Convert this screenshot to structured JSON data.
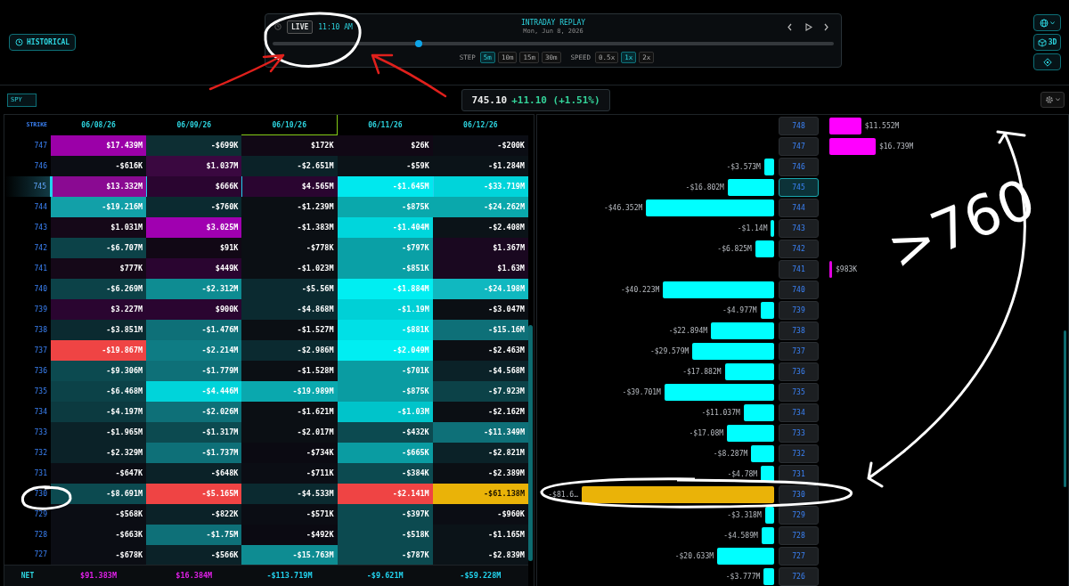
{
  "historical": {
    "label": "HISTORICAL"
  },
  "replay": {
    "live_label": "LIVE",
    "time": "11:10 AM",
    "title": "INTRADAY REPLAY",
    "date": "Mon, Jun 8, 2026",
    "level": 0.26,
    "step_label": "STEP",
    "steps": [
      {
        "label": "5m",
        "selected": true
      },
      {
        "label": "10m",
        "selected": false
      },
      {
        "label": "15m",
        "selected": false
      },
      {
        "label": "30m",
        "selected": false
      }
    ],
    "speed_label": "SPEED",
    "speeds": [
      {
        "label": "0.5x",
        "selected": false
      },
      {
        "label": "1x",
        "selected": true
      },
      {
        "label": "2x",
        "selected": false
      }
    ]
  },
  "side_buttons": [
    {
      "kind": "globe"
    },
    {
      "kind": "cube",
      "label": "3D"
    },
    {
      "kind": "diamond"
    }
  ],
  "symbol_field": {
    "value": "SPY"
  },
  "quote": {
    "price": "745.10",
    "change": "+11.10 (+1.51%)"
  },
  "table": {
    "strike_header": "STRIKE",
    "columns": [
      {
        "label": "06/08/26",
        "selected": false
      },
      {
        "label": "06/09/26",
        "selected": false
      },
      {
        "label": "06/10/26",
        "selected": true
      },
      {
        "label": "06/11/26",
        "selected": false
      },
      {
        "label": "06/12/26",
        "selected": false
      }
    ],
    "rows": [
      {
        "strike": "747",
        "current": false,
        "cells": [
          {
            "value": "$17.439M",
            "color": "#9b00a8"
          },
          {
            "value": "-$699K",
            "color": "#0d2e33"
          },
          {
            "value": "$172K",
            "color": "#110815"
          },
          {
            "value": "$26K",
            "color": "#110815"
          },
          {
            "value": "-$200K",
            "color": "#0b0d14"
          }
        ]
      },
      {
        "strike": "746",
        "current": false,
        "cells": [
          {
            "value": "-$616K",
            "color": "#0b0d14"
          },
          {
            "value": "$1.037M",
            "color": "#3a0840"
          },
          {
            "value": "-$2.651M",
            "color": "#0b2228"
          },
          {
            "value": "-$59K",
            "color": "#0b1318"
          },
          {
            "value": "-$1.284M",
            "color": "#0b1318"
          }
        ]
      },
      {
        "strike": "745",
        "current": true,
        "cells": [
          {
            "value": "$13.332M",
            "color": "#8a0a92"
          },
          {
            "value": "$666K",
            "color": "#2a0530"
          },
          {
            "value": "$4.565M",
            "color": "#2a0530"
          },
          {
            "value": "-$1.645M",
            "color": "#00e8ee"
          },
          {
            "value": "-$33.719M",
            "color": "#00d4da"
          }
        ]
      },
      {
        "strike": "744",
        "current": false,
        "cells": [
          {
            "value": "-$19.216M",
            "color": "#12a0a8"
          },
          {
            "value": "-$760K",
            "color": "#0b2a30"
          },
          {
            "value": "-$1.239M",
            "color": "#0b0f14"
          },
          {
            "value": "-$875K",
            "color": "#0aa8ac"
          },
          {
            "value": "-$24.262M",
            "color": "#0aa8ac"
          }
        ]
      },
      {
        "strike": "743",
        "current": false,
        "cells": [
          {
            "value": "$1.031M",
            "color": "#150818"
          },
          {
            "value": "$3.025M",
            "color": "#a000b0"
          },
          {
            "value": "-$1.383M",
            "color": "#0b0f14"
          },
          {
            "value": "-$1.404M",
            "color": "#00d6dc"
          },
          {
            "value": "-$2.408M",
            "color": "#0b1318"
          }
        ]
      },
      {
        "strike": "742",
        "current": false,
        "cells": [
          {
            "value": "-$6.707M",
            "color": "#0c4248"
          },
          {
            "value": "$91K",
            "color": "#110815"
          },
          {
            "value": "-$778K",
            "color": "#0b0f14"
          },
          {
            "value": "-$797K",
            "color": "#0aa0a6"
          },
          {
            "value": "$1.367M",
            "color": "#1a0820"
          }
        ]
      },
      {
        "strike": "741",
        "current": false,
        "cells": [
          {
            "value": "$777K",
            "color": "#150818"
          },
          {
            "value": "$449K",
            "color": "#2a0530"
          },
          {
            "value": "-$1.023M",
            "color": "#0b0f14"
          },
          {
            "value": "-$851K",
            "color": "#0aa0a6"
          },
          {
            "value": "$1.63M",
            "color": "#1a0820"
          }
        ]
      },
      {
        "strike": "740",
        "current": false,
        "cells": [
          {
            "value": "-$6.269M",
            "color": "#0c4248"
          },
          {
            "value": "-$2.312M",
            "color": "#0e8c92"
          },
          {
            "value": "-$5.56M",
            "color": "#0b2a30"
          },
          {
            "value": "-$1.884M",
            "color": "#00eef2"
          },
          {
            "value": "-$24.198M",
            "color": "#10b8c0"
          }
        ]
      },
      {
        "strike": "739",
        "current": false,
        "cells": [
          {
            "value": "$3.227M",
            "color": "#2a0530"
          },
          {
            "value": "$900K",
            "color": "#2a0530"
          },
          {
            "value": "-$4.868M",
            "color": "#0b2a30"
          },
          {
            "value": "-$1.19M",
            "color": "#00d0d6"
          },
          {
            "value": "-$3.047M",
            "color": "#0b0f14"
          }
        ]
      },
      {
        "strike": "738",
        "current": false,
        "cells": [
          {
            "value": "-$3.851M",
            "color": "#0b2a30"
          },
          {
            "value": "-$1.476M",
            "color": "#0e7078"
          },
          {
            "value": "-$1.527M",
            "color": "#0b0f14"
          },
          {
            "value": "-$881K",
            "color": "#00e0e6"
          },
          {
            "value": "-$15.16M",
            "color": "#0e7078"
          }
        ]
      },
      {
        "strike": "737",
        "current": false,
        "cells": [
          {
            "value": "-$19.867M",
            "color": "#ef4444"
          },
          {
            "value": "-$2.214M",
            "color": "#0e7c84"
          },
          {
            "value": "-$2.986M",
            "color": "#0b2a30"
          },
          {
            "value": "-$2.049M",
            "color": "#00eef2"
          },
          {
            "value": "-$2.463M",
            "color": "#0b0f14"
          }
        ]
      },
      {
        "strike": "736",
        "current": false,
        "cells": [
          {
            "value": "-$9.306M",
            "color": "#0c4a50"
          },
          {
            "value": "-$1.779M",
            "color": "#0e7078"
          },
          {
            "value": "-$1.528M",
            "color": "#0b0f14"
          },
          {
            "value": "-$701K",
            "color": "#0a9ca2"
          },
          {
            "value": "-$4.568M",
            "color": "#0b2228"
          }
        ]
      },
      {
        "strike": "735",
        "current": false,
        "cells": [
          {
            "value": "-$6.468M",
            "color": "#0c4248"
          },
          {
            "value": "-$4.446M",
            "color": "#00d4da"
          },
          {
            "value": "-$19.989M",
            "color": "#0aa8ae"
          },
          {
            "value": "-$875K",
            "color": "#0a9ca2"
          },
          {
            "value": "-$7.923M",
            "color": "#0c4248"
          }
        ]
      },
      {
        "strike": "734",
        "current": false,
        "cells": [
          {
            "value": "-$4.197M",
            "color": "#0c3a40"
          },
          {
            "value": "-$2.026M",
            "color": "#0e7078"
          },
          {
            "value": "-$1.621M",
            "color": "#0b0f14"
          },
          {
            "value": "-$1.03M",
            "color": "#00c4ca"
          },
          {
            "value": "-$2.162M",
            "color": "#0b0f14"
          }
        ]
      },
      {
        "strike": "733",
        "current": false,
        "cells": [
          {
            "value": "-$1.965M",
            "color": "#0b2228"
          },
          {
            "value": "-$1.317M",
            "color": "#0c4a50"
          },
          {
            "value": "-$2.017M",
            "color": "#0b0f14"
          },
          {
            "value": "-$432K",
            "color": "#0c4a50"
          },
          {
            "value": "-$11.349M",
            "color": "#0e7078"
          }
        ]
      },
      {
        "strike": "732",
        "current": false,
        "cells": [
          {
            "value": "-$2.329M",
            "color": "#0b2228"
          },
          {
            "value": "-$1.737M",
            "color": "#0e7078"
          },
          {
            "value": "-$734K",
            "color": "#0b0a12"
          },
          {
            "value": "-$665K",
            "color": "#0a9ca2"
          },
          {
            "value": "-$2.821M",
            "color": "#0b2228"
          }
        ]
      },
      {
        "strike": "731",
        "current": false,
        "cells": [
          {
            "value": "-$647K",
            "color": "#0b0d14"
          },
          {
            "value": "-$648K",
            "color": "#0b2228"
          },
          {
            "value": "-$711K",
            "color": "#0b0d14"
          },
          {
            "value": "-$384K",
            "color": "#0c4a50"
          },
          {
            "value": "-$2.389M",
            "color": "#0b0f14"
          }
        ]
      },
      {
        "strike": "730",
        "current": false,
        "cells": [
          {
            "value": "-$8.691M",
            "color": "#0c4a50"
          },
          {
            "value": "-$5.165M",
            "color": "#ef4444"
          },
          {
            "value": "-$4.533M",
            "color": "#0b2a30"
          },
          {
            "value": "-$2.141M",
            "color": "#ef4444"
          },
          {
            "value": "-$61.138M",
            "color": "#eab308"
          }
        ]
      },
      {
        "strike": "729",
        "current": false,
        "cells": [
          {
            "value": "-$568K",
            "color": "#0b0d14"
          },
          {
            "value": "-$822K",
            "color": "#0b2228"
          },
          {
            "value": "-$571K",
            "color": "#0b0d14"
          },
          {
            "value": "-$397K",
            "color": "#0c4a50"
          },
          {
            "value": "-$960K",
            "color": "#0b0d14"
          }
        ]
      },
      {
        "strike": "728",
        "current": false,
        "cells": [
          {
            "value": "-$663K",
            "color": "#0b0d14"
          },
          {
            "value": "-$1.75M",
            "color": "#0e7078"
          },
          {
            "value": "-$492K",
            "color": "#0b0a12"
          },
          {
            "value": "-$518K",
            "color": "#0c4a50"
          },
          {
            "value": "-$1.165M",
            "color": "#0b1318"
          }
        ]
      },
      {
        "strike": "727",
        "current": false,
        "cells": [
          {
            "value": "-$678K",
            "color": "#0b0d14"
          },
          {
            "value": "-$566K",
            "color": "#0b2228"
          },
          {
            "value": "-$15.763M",
            "color": "#0e8c92"
          },
          {
            "value": "-$787K",
            "color": "#0c4a50"
          },
          {
            "value": "-$2.839M",
            "color": "#0b1318"
          }
        ]
      }
    ],
    "net_label": "NET",
    "net": [
      {
        "value": "$91.383M",
        "color": "#e020e8"
      },
      {
        "value": "$16.384M",
        "color": "#e020e8"
      },
      {
        "value": "-$113.719M",
        "color": "#22d3ee"
      },
      {
        "value": "-$9.621M",
        "color": "#22d3ee"
      },
      {
        "value": "-$59.228M",
        "color": "#22d3ee"
      }
    ]
  },
  "chart_rows": [
    {
      "strike": "748",
      "current": false,
      "kind": "positive",
      "label": "$11.552M",
      "color": "#ff00ff"
    },
    {
      "strike": "747",
      "current": false,
      "kind": "positive",
      "label": "$16.739M",
      "color": "#ff00ff"
    },
    {
      "strike": "746",
      "current": false,
      "kind": "negative",
      "label": "-$3.573M",
      "color": "#00ffff"
    },
    {
      "strike": "745",
      "current": true,
      "kind": "negative",
      "label": "-$16.802M",
      "color": "#00ffff"
    },
    {
      "strike": "744",
      "current": false,
      "kind": "negative",
      "label": "-$46.352M",
      "color": "#00ffff"
    },
    {
      "strike": "743",
      "current": false,
      "kind": "negative",
      "label": "-$1.14M",
      "color": "#00ffff"
    },
    {
      "strike": "742",
      "current": false,
      "kind": "negative",
      "label": "-$6.825M",
      "color": "#00ffff"
    },
    {
      "strike": "741",
      "current": false,
      "kind": "positive",
      "label": "$983K",
      "color": "#e000e0"
    },
    {
      "strike": "740",
      "current": false,
      "kind": "negative",
      "label": "-$40.223M",
      "color": "#00ffff"
    },
    {
      "strike": "739",
      "current": false,
      "kind": "negative",
      "label": "-$4.977M",
      "color": "#00ffff"
    },
    {
      "strike": "738",
      "current": false,
      "kind": "negative",
      "label": "-$22.894M",
      "color": "#00ffff"
    },
    {
      "strike": "737",
      "current": false,
      "kind": "negative",
      "label": "-$29.579M",
      "color": "#00ffff"
    },
    {
      "strike": "736",
      "current": false,
      "kind": "negative",
      "label": "-$17.882M",
      "color": "#00ffff"
    },
    {
      "strike": "735",
      "current": false,
      "kind": "negative",
      "label": "-$39.701M",
      "color": "#00ffff"
    },
    {
      "strike": "734",
      "current": false,
      "kind": "negative",
      "label": "-$11.037M",
      "color": "#00ffff"
    },
    {
      "strike": "733",
      "current": false,
      "kind": "negative",
      "label": "-$17.08M",
      "color": "#00ffff"
    },
    {
      "strike": "732",
      "current": false,
      "kind": "negative",
      "label": "-$8.287M",
      "color": "#00ffff"
    },
    {
      "strike": "731",
      "current": false,
      "kind": "negative",
      "label": "-$4.78M",
      "color": "#00ffff"
    },
    {
      "strike": "730",
      "current": false,
      "kind": "negative",
      "label": "-$81.6…",
      "color": "#eab308"
    },
    {
      "strike": "729",
      "current": false,
      "kind": "negative",
      "label": "-$3.318M",
      "color": "#00ffff"
    },
    {
      "strike": "728",
      "current": false,
      "kind": "negative",
      "label": "-$4.589M",
      "color": "#00ffff"
    },
    {
      "strike": "727",
      "current": false,
      "kind": "negative",
      "label": "-$20.633M",
      "color": "#00ffff"
    },
    {
      "strike": "726",
      "current": false,
      "kind": "negative",
      "label": "-$3.777M",
      "color": "#00ffff"
    }
  ],
  "annotations": {
    "note": ">760"
  }
}
